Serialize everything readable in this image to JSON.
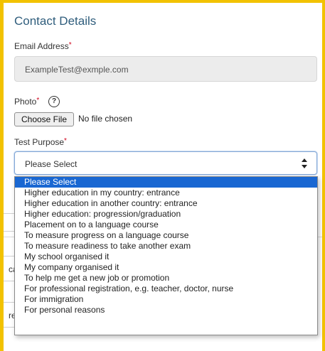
{
  "form": {
    "section_title": "Contact Details",
    "email": {
      "label": "Email Address",
      "required_mark": "*",
      "value": "ExampleTest@exmple.com"
    },
    "photo": {
      "label": "Photo",
      "required_mark": "*",
      "help_icon": "help-circle-icon",
      "help_glyph": "?",
      "button_label": "Choose File",
      "status": "No file chosen"
    },
    "test_purpose": {
      "label": "Test Purpose",
      "required_mark": "*",
      "selected": "Please Select",
      "options": [
        "Please Select",
        "Higher education in my country: entrance",
        "Higher education in another country: entrance",
        "Higher education: progression/graduation",
        "Placement on to a language course",
        "To measure progress on a language course",
        "To measure readiness to take another exam",
        "My school organised it",
        "My company organised it",
        "To help me get a new job or promotion",
        "For professional registration, e.g. teacher, doctor, nurse",
        "For immigration",
        "For personal reasons"
      ]
    }
  },
  "colors": {
    "frame": "#f2c200",
    "title": "#2f5d7c",
    "required": "#d0021b",
    "highlight": "#1967d2"
  }
}
